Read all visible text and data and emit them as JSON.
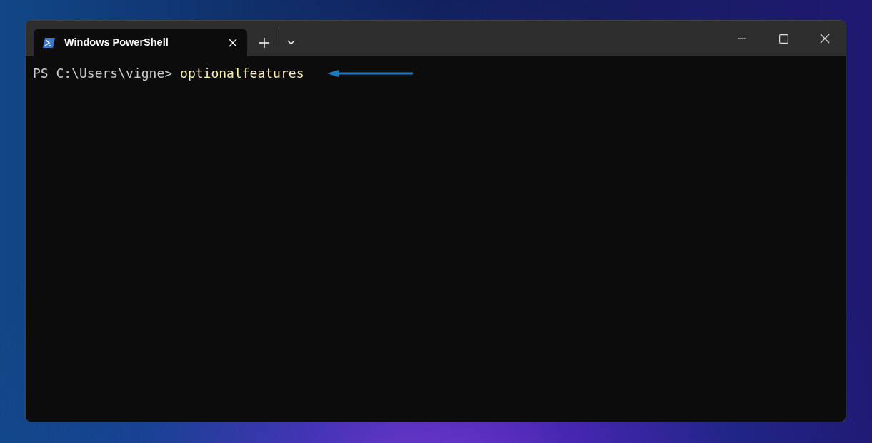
{
  "tabs": [
    {
      "title": "Windows PowerShell",
      "selected": true
    }
  ],
  "terminal": {
    "prompt": "PS C:\\Users\\vigne>",
    "command": "optionalfeatures"
  }
}
